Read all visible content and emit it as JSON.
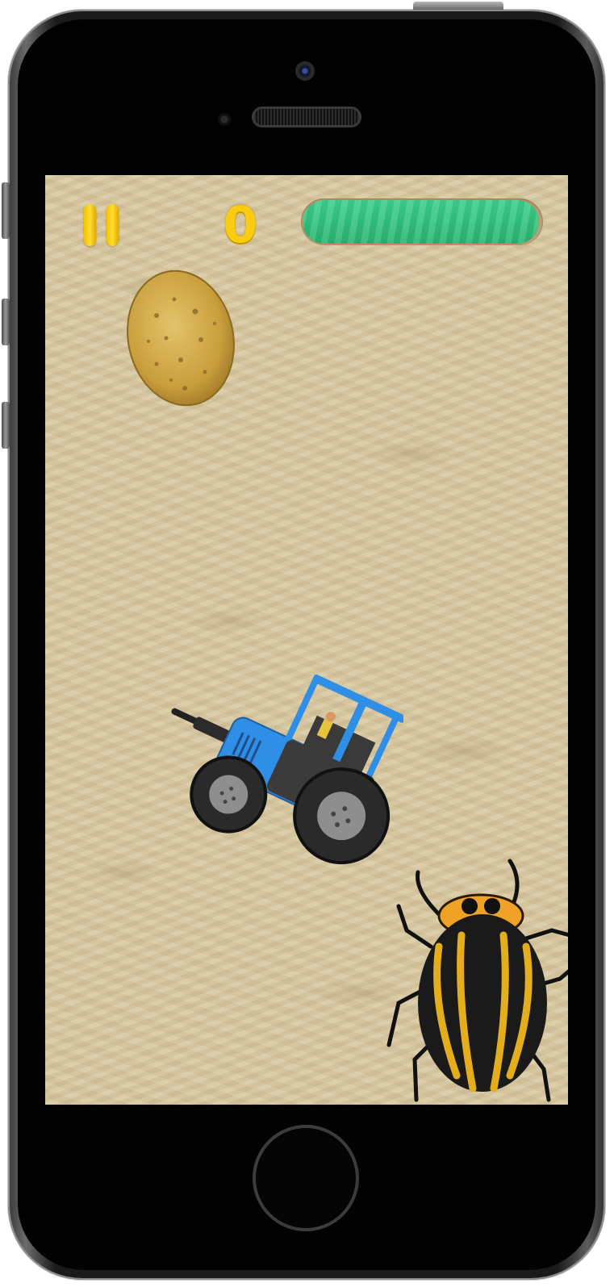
{
  "game": {
    "score": "0",
    "health_fraction": 0.99,
    "colors": {
      "coin": "#f9cc12",
      "health": "#2fc27d",
      "sand": "#d7c79f",
      "tractor_body": "#2e8fe6",
      "beetle_stripe": "#e4ad1c"
    },
    "icons": {
      "pause": "pause-icon",
      "potato": "potato-sprite",
      "tractor": "tractor-sprite",
      "beetle": "beetle-sprite"
    }
  }
}
